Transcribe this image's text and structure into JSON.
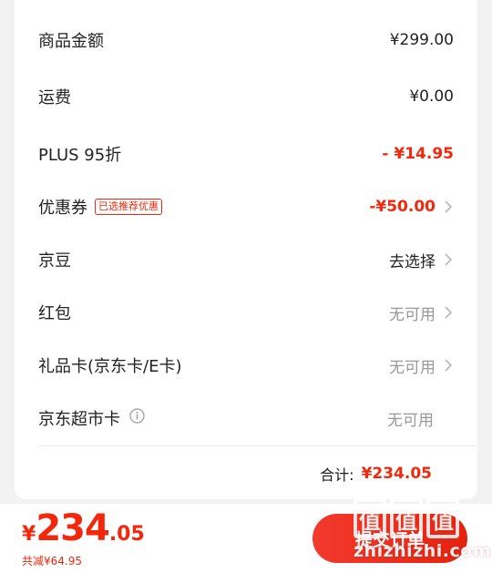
{
  "rows": [
    {
      "label": "商品金额",
      "value": "¥299.00",
      "style": "dark"
    },
    {
      "label": "运费",
      "value": "¥0.00",
      "style": "dark"
    },
    {
      "label": "PLUS 95折",
      "value": "- ¥14.95",
      "style": "red"
    },
    {
      "label": "优惠券",
      "tag": "已选推荐优惠",
      "value": "-¥50.00",
      "style": "red",
      "chevron": true
    },
    {
      "label": "京豆",
      "value": "去选择",
      "style": "dark",
      "chevron": true
    },
    {
      "label": "红包",
      "value": "无可用",
      "style": "gray",
      "chevron": true
    },
    {
      "label": "礼品卡(京东卡/E卡)",
      "value": "无可用",
      "style": "gray",
      "chevron": true
    },
    {
      "label": "京东超市卡",
      "value": "无可用",
      "style": "gray",
      "info_icon": true
    }
  ],
  "total": {
    "label": "合计:",
    "value": "¥234.05"
  },
  "bottom": {
    "price_yen": "¥",
    "price_int": "234",
    "price_dec": ".05",
    "saved": "共减¥64.95",
    "submit_label": "提交订单"
  },
  "watermark": {
    "chars": [
      "值",
      "值",
      "值"
    ],
    "url": "zhizhizhi.com"
  },
  "colors": {
    "accent": "#f2270c",
    "muted": "#999999"
  }
}
